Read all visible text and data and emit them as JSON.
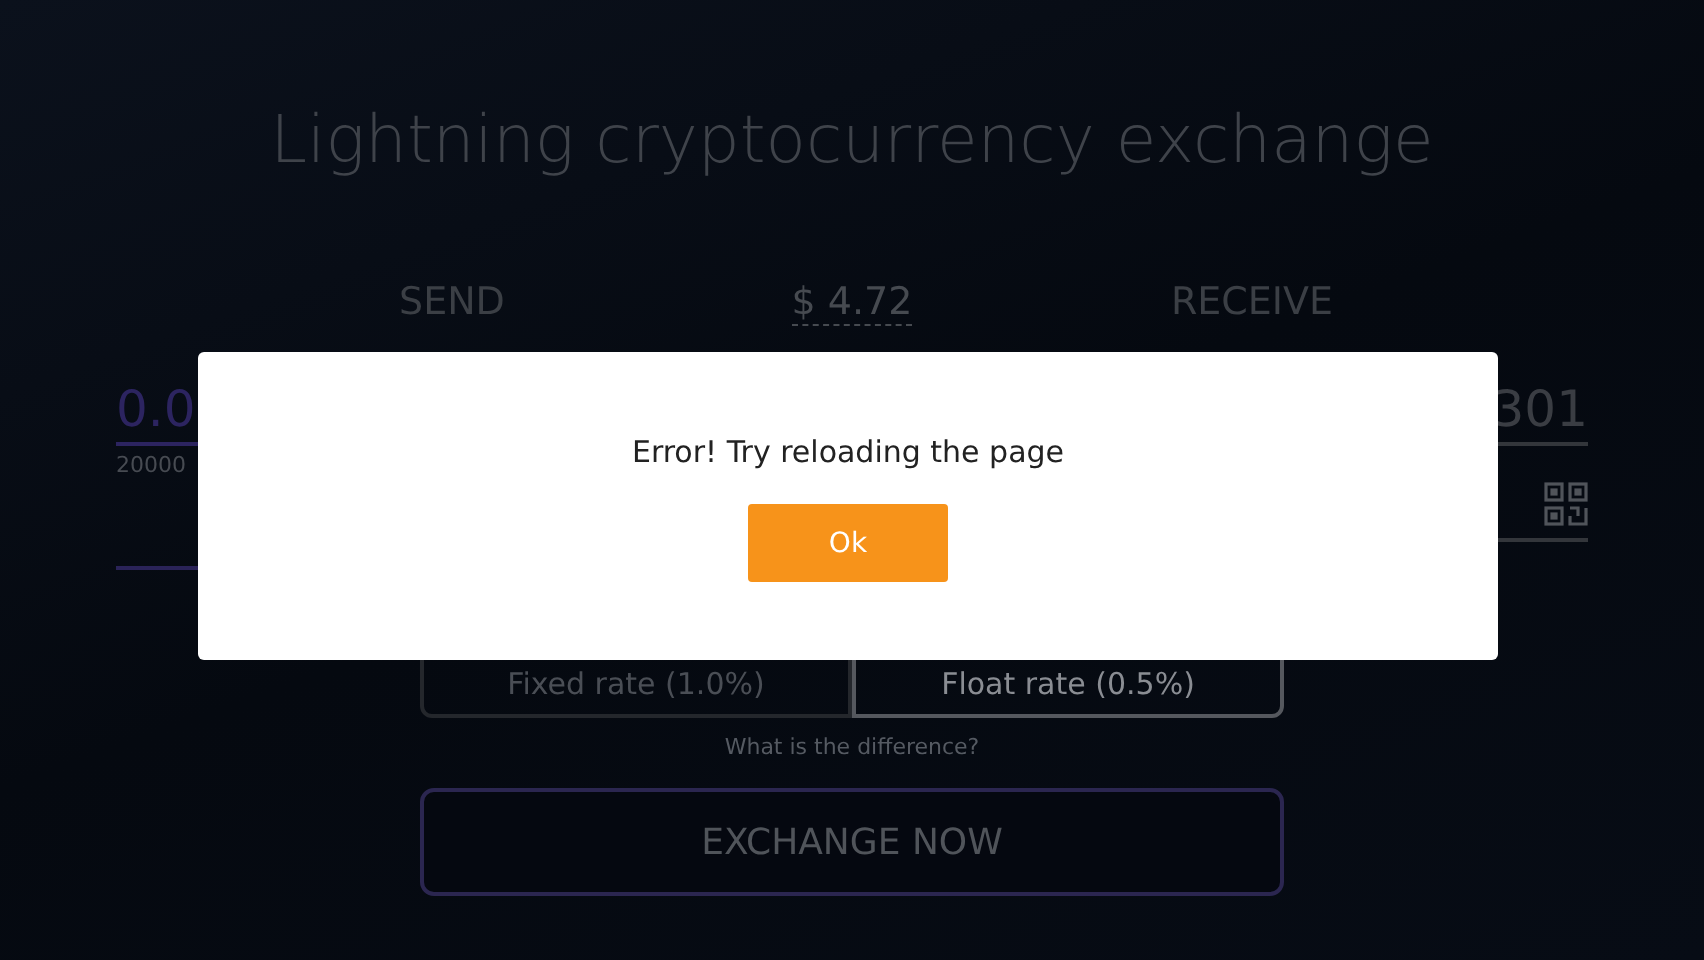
{
  "title": "Lightning cryptocurrency exchange",
  "send": {
    "label": "SEND",
    "amount": "0.0",
    "hint": "20000"
  },
  "price": "$ 4.72",
  "receive": {
    "label": "RECEIVE",
    "amount": "301"
  },
  "rates": [
    {
      "label": "Fixed rate (1.0%)",
      "selected": false
    },
    {
      "label": "Float rate (0.5%)",
      "selected": true
    }
  ],
  "difference_link": "What is the difference?",
  "exchange_button": "EXCHANGE NOW",
  "dialog": {
    "message": "Error! Try reloading the page",
    "button": "Ok"
  }
}
